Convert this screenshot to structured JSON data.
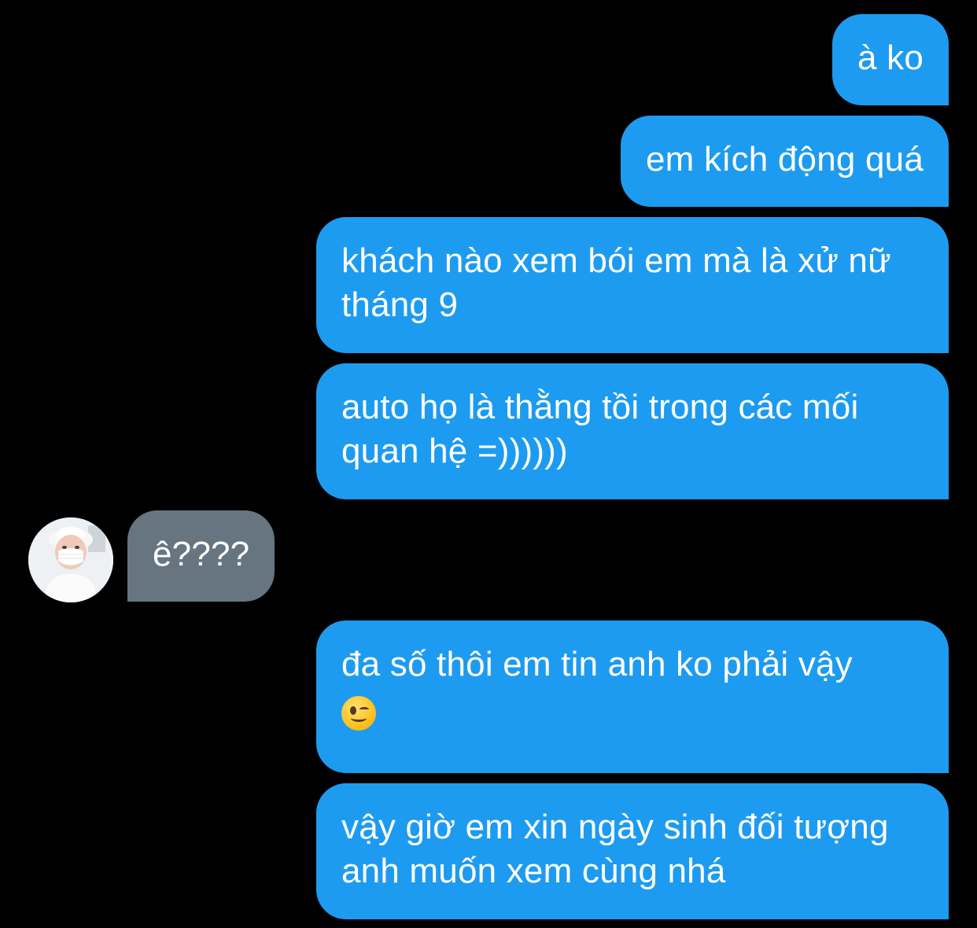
{
  "messages": [
    {
      "id": "m1",
      "direction": "sent",
      "text": "à ko"
    },
    {
      "id": "m2",
      "direction": "sent",
      "text": "em kích động quá"
    },
    {
      "id": "m3",
      "direction": "sent",
      "text": "khách nào xem bói em mà là xử nữ tháng 9"
    },
    {
      "id": "m4",
      "direction": "sent",
      "text": "auto họ là thằng tồi trong các mối quan hệ =))))))"
    },
    {
      "id": "m5",
      "direction": "received",
      "text": "ê????"
    },
    {
      "id": "m6",
      "direction": "sent",
      "text": "đa số thôi em tin anh ko phải vậy",
      "emoji": "winking-face"
    },
    {
      "id": "m7",
      "direction": "sent",
      "text": "vậy giờ em xin ngày sinh đối tượng anh muốn xem cùng nhá"
    }
  ],
  "contact": {
    "avatar_icon": "contact-avatar"
  },
  "colors": {
    "background": "#000000",
    "sent_bubble": "#1d9bf0",
    "received_bubble": "#66757f",
    "text": "#ffffff"
  }
}
